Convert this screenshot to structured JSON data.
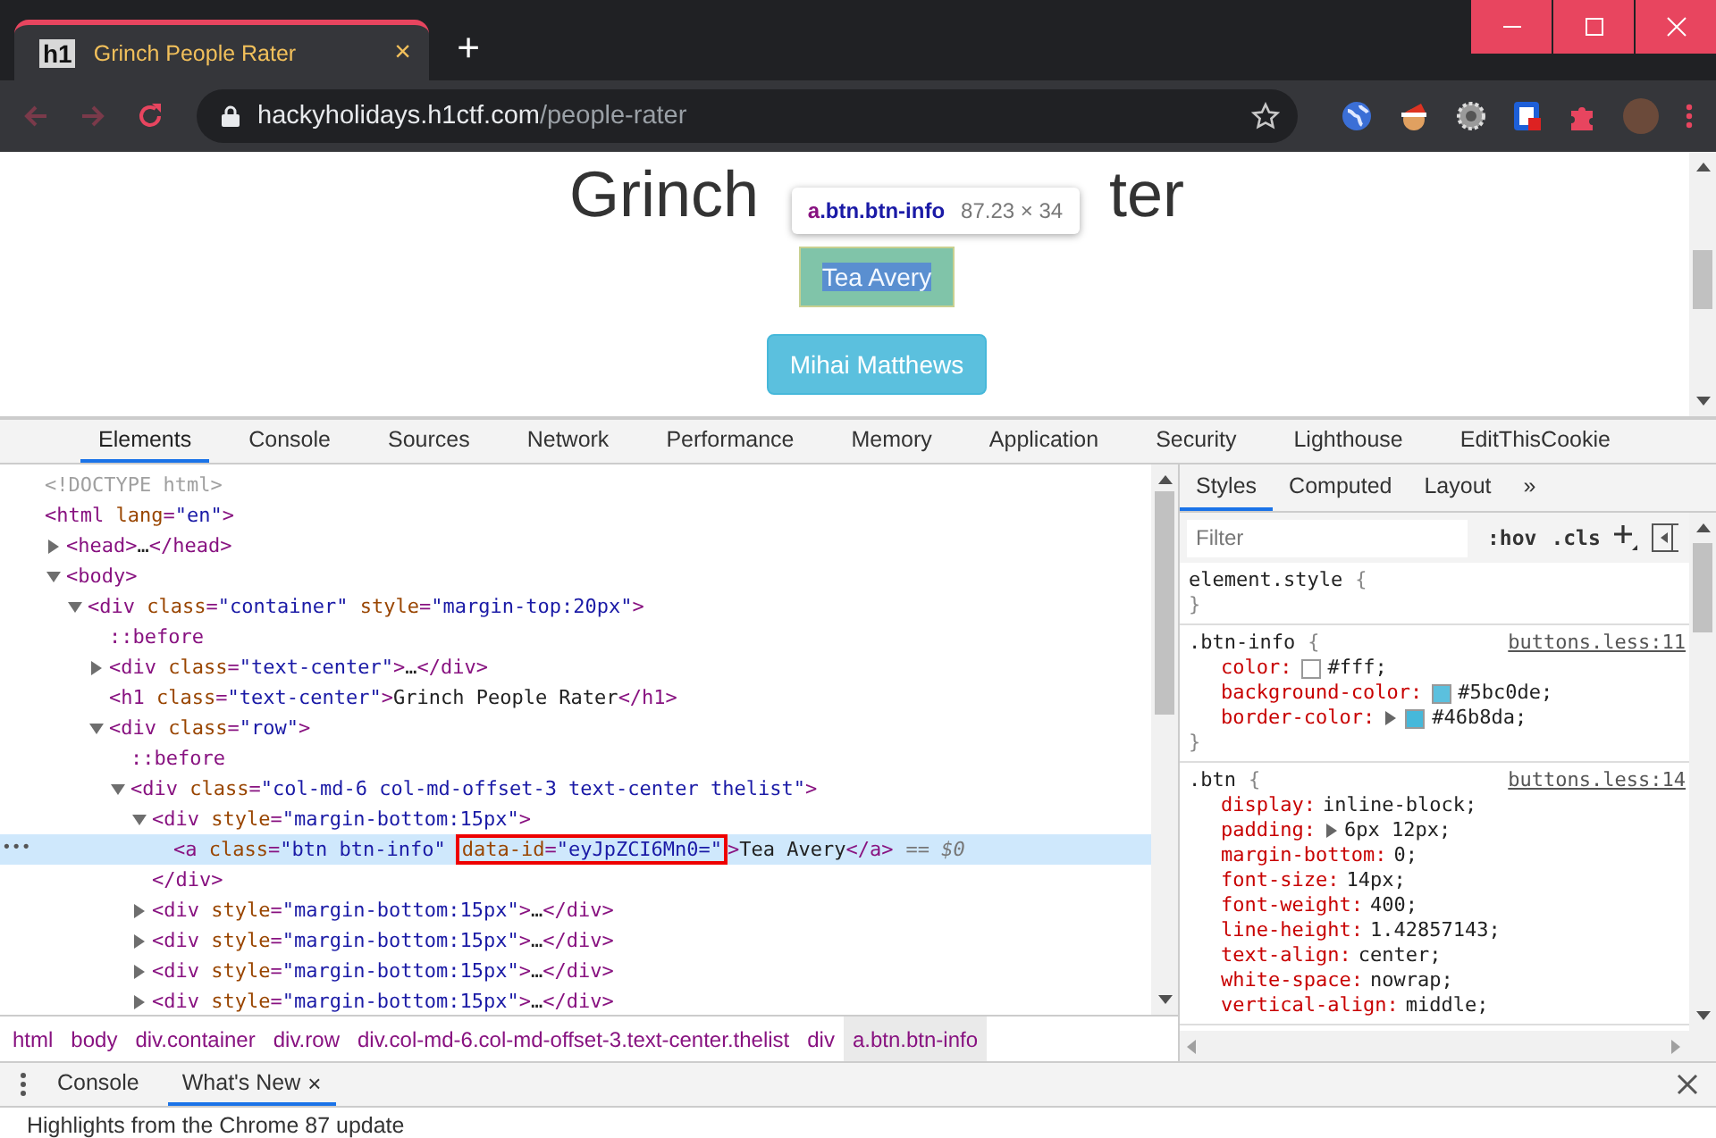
{
  "browser": {
    "tab": {
      "title": "Grinch People Rater",
      "favicon": "h1",
      "close": "×"
    },
    "new_tab": "+",
    "url": {
      "host": "hackyholidays.h1ctf.com",
      "path": "/people-rater"
    }
  },
  "page": {
    "heading": {
      "before": "Grinch",
      "after": "ter"
    },
    "buttons": [
      {
        "label": "Tea Avery",
        "inspected": true
      },
      {
        "label": "Mihai Matthews",
        "inspected": false
      }
    ],
    "tooltip": {
      "tag": "a",
      "classes": ".btn.btn-info",
      "size": "87.23 × 34"
    }
  },
  "devtools": {
    "tabs": [
      {
        "label": "Elements",
        "selected": true
      },
      {
        "label": "Console",
        "selected": false
      },
      {
        "label": "Sources",
        "selected": false
      },
      {
        "label": "Network",
        "selected": false
      },
      {
        "label": "Performance",
        "selected": false
      },
      {
        "label": "Memory",
        "selected": false
      },
      {
        "label": "Application",
        "selected": false
      },
      {
        "label": "Security",
        "selected": false
      },
      {
        "label": "Lighthouse",
        "selected": false
      },
      {
        "label": "EditThisCookie",
        "selected": false
      }
    ],
    "dom": [
      {
        "kind": "plain",
        "selected": false,
        "parts": [
          {
            "kind": "comment",
            "text": "<!DOCTYPE html>"
          }
        ]
      },
      {
        "kind": "plain",
        "selected": false,
        "parts": [
          {
            "kind": "tag",
            "text": "<html"
          },
          {
            "kind": "attr",
            "text": " lang"
          },
          {
            "kind": "tag",
            "text": "="
          },
          {
            "kind": "value",
            "text": "\"en\""
          },
          {
            "kind": "tag",
            "text": ">"
          }
        ],
        "children": [
          {
            "kind": "collapsible",
            "expanded": false,
            "selected": false,
            "parts": [
              {
                "kind": "tag",
                "text": "<head>"
              },
              {
                "kind": "text",
                "text": "…"
              },
              {
                "kind": "tag",
                "text": "</head>"
              }
            ]
          },
          {
            "kind": "collapsible",
            "expanded": true,
            "selected": false,
            "parts": [
              {
                "kind": "tag",
                "text": "<body>"
              }
            ],
            "children": [
              {
                "kind": "collapsible",
                "expanded": true,
                "selected": false,
                "parts": [
                  {
                    "kind": "tag",
                    "text": "<div"
                  },
                  {
                    "kind": "attr",
                    "text": " class"
                  },
                  {
                    "kind": "tag",
                    "text": "="
                  },
                  {
                    "kind": "value",
                    "text": "\"container\""
                  },
                  {
                    "kind": "attr",
                    "text": " style"
                  },
                  {
                    "kind": "tag",
                    "text": "="
                  },
                  {
                    "kind": "value",
                    "text": "\"margin-top:20px\""
                  },
                  {
                    "kind": "tag",
                    "text": ">"
                  }
                ],
                "children": [
                  {
                    "kind": "plain",
                    "selected": false,
                    "parts": [
                      {
                        "kind": "pseudo",
                        "text": "::before"
                      }
                    ]
                  },
                  {
                    "kind": "collapsible",
                    "expanded": false,
                    "selected": false,
                    "parts": [
                      {
                        "kind": "tag",
                        "text": "<div"
                      },
                      {
                        "kind": "attr",
                        "text": " class"
                      },
                      {
                        "kind": "tag",
                        "text": "="
                      },
                      {
                        "kind": "value",
                        "text": "\"text-center\""
                      },
                      {
                        "kind": "tag",
                        "text": ">"
                      },
                      {
                        "kind": "text",
                        "text": "…"
                      },
                      {
                        "kind": "tag",
                        "text": "</div>"
                      }
                    ]
                  },
                  {
                    "kind": "plain",
                    "selected": false,
                    "parts": [
                      {
                        "kind": "tag",
                        "text": "<h1"
                      },
                      {
                        "kind": "attr",
                        "text": " class"
                      },
                      {
                        "kind": "tag",
                        "text": "="
                      },
                      {
                        "kind": "value",
                        "text": "\"text-center\""
                      },
                      {
                        "kind": "tag",
                        "text": ">"
                      },
                      {
                        "kind": "text",
                        "text": "Grinch People Rater"
                      },
                      {
                        "kind": "tag",
                        "text": "</h1>"
                      }
                    ]
                  },
                  {
                    "kind": "collapsible",
                    "expanded": true,
                    "selected": false,
                    "parts": [
                      {
                        "kind": "tag",
                        "text": "<div"
                      },
                      {
                        "kind": "attr",
                        "text": " class"
                      },
                      {
                        "kind": "tag",
                        "text": "="
                      },
                      {
                        "kind": "value",
                        "text": "\"row\""
                      },
                      {
                        "kind": "tag",
                        "text": ">"
                      }
                    ],
                    "children": [
                      {
                        "kind": "plain",
                        "selected": false,
                        "parts": [
                          {
                            "kind": "pseudo",
                            "text": "::before"
                          }
                        ]
                      },
                      {
                        "kind": "collapsible",
                        "expanded": true,
                        "selected": false,
                        "parts": [
                          {
                            "kind": "tag",
                            "text": "<div"
                          },
                          {
                            "kind": "attr",
                            "text": " class"
                          },
                          {
                            "kind": "tag",
                            "text": "="
                          },
                          {
                            "kind": "value",
                            "text": "\"col-md-6 col-md-offset-3 text-center thelist\""
                          },
                          {
                            "kind": "tag",
                            "text": ">"
                          }
                        ],
                        "children": [
                          {
                            "kind": "collapsible",
                            "expanded": true,
                            "selected": false,
                            "parts": [
                              {
                                "kind": "tag",
                                "text": "<div"
                              },
                              {
                                "kind": "attr",
                                "text": " style"
                              },
                              {
                                "kind": "tag",
                                "text": "="
                              },
                              {
                                "kind": "value",
                                "text": "\"margin-bottom:15px\""
                              },
                              {
                                "kind": "tag",
                                "text": ">"
                              }
                            ],
                            "close": "</div>",
                            "children": [
                              {
                                "kind": "plain",
                                "selected": true,
                                "gutter": "•••",
                                "suffix": "== $0",
                                "parts": [
                                  {
                                    "kind": "tag",
                                    "text": "<a"
                                  },
                                  {
                                    "kind": "attr",
                                    "text": " class"
                                  },
                                  {
                                    "kind": "tag",
                                    "text": "="
                                  },
                                  {
                                    "kind": "value",
                                    "text": "\"btn btn-info\""
                                  },
                                  {
                                    "kind": "marked",
                                    "parts": [
                                      {
                                        "kind": "attr",
                                        "text": "data-id"
                                      },
                                      {
                                        "kind": "tag",
                                        "text": "="
                                      },
                                      {
                                        "kind": "value",
                                        "text": "\"eyJpZCI6Mn0=\""
                                      }
                                    ]
                                  },
                                  {
                                    "kind": "tag",
                                    "text": ">"
                                  },
                                  {
                                    "kind": "text",
                                    "text": "Tea Avery"
                                  },
                                  {
                                    "kind": "tag",
                                    "text": "</a>"
                                  }
                                ]
                              }
                            ]
                          },
                          {
                            "kind": "collapsible",
                            "expanded": false,
                            "selected": false,
                            "parts": [
                              {
                                "kind": "tag",
                                "text": "<div"
                              },
                              {
                                "kind": "attr",
                                "text": " style"
                              },
                              {
                                "kind": "tag",
                                "text": "="
                              },
                              {
                                "kind": "value",
                                "text": "\"margin-bottom:15px\""
                              },
                              {
                                "kind": "tag",
                                "text": ">"
                              },
                              {
                                "kind": "text",
                                "text": "…"
                              },
                              {
                                "kind": "tag",
                                "text": "</div>"
                              }
                            ]
                          },
                          {
                            "kind": "collapsible",
                            "expanded": false,
                            "selected": false,
                            "parts": [
                              {
                                "kind": "tag",
                                "text": "<div"
                              },
                              {
                                "kind": "attr",
                                "text": " style"
                              },
                              {
                                "kind": "tag",
                                "text": "="
                              },
                              {
                                "kind": "value",
                                "text": "\"margin-bottom:15px\""
                              },
                              {
                                "kind": "tag",
                                "text": ">"
                              },
                              {
                                "kind": "text",
                                "text": "…"
                              },
                              {
                                "kind": "tag",
                                "text": "</div>"
                              }
                            ]
                          },
                          {
                            "kind": "collapsible",
                            "expanded": false,
                            "selected": false,
                            "parts": [
                              {
                                "kind": "tag",
                                "text": "<div"
                              },
                              {
                                "kind": "attr",
                                "text": " style"
                              },
                              {
                                "kind": "tag",
                                "text": "="
                              },
                              {
                                "kind": "value",
                                "text": "\"margin-bottom:15px\""
                              },
                              {
                                "kind": "tag",
                                "text": ">"
                              },
                              {
                                "kind": "text",
                                "text": "…"
                              },
                              {
                                "kind": "tag",
                                "text": "</div>"
                              }
                            ]
                          },
                          {
                            "kind": "collapsible",
                            "expanded": false,
                            "selected": false,
                            "parts": [
                              {
                                "kind": "tag",
                                "text": "<div"
                              },
                              {
                                "kind": "attr",
                                "text": " style"
                              },
                              {
                                "kind": "tag",
                                "text": "="
                              },
                              {
                                "kind": "value",
                                "text": "\"margin-bottom:15px\""
                              },
                              {
                                "kind": "tag",
                                "text": ">"
                              },
                              {
                                "kind": "text",
                                "text": "…"
                              },
                              {
                                "kind": "tag",
                                "text": "</div>"
                              }
                            ]
                          }
                        ]
                      }
                    ]
                  }
                ]
              }
            ]
          }
        ]
      }
    ],
    "breadcrumbs": [
      {
        "label": "html",
        "selected": false
      },
      {
        "label": "body",
        "selected": false
      },
      {
        "label": "div.container",
        "selected": false
      },
      {
        "label": "div.row",
        "selected": false
      },
      {
        "label": "div.col-md-6.col-md-offset-3.text-center.thelist",
        "selected": false
      },
      {
        "label": "div",
        "selected": false
      },
      {
        "label": "a.btn.btn-info",
        "selected": true
      }
    ],
    "side_tabs": [
      {
        "label": "Styles",
        "selected": true
      },
      {
        "label": "Computed",
        "selected": false
      },
      {
        "label": "Layout",
        "selected": false
      },
      {
        "label": "»",
        "selected": false
      }
    ],
    "filter": {
      "placeholder": "Filter"
    },
    "filter_buttons": [
      ":hov",
      ".cls"
    ],
    "rules": [
      {
        "selector": "element.style",
        "open": "{",
        "close": "}"
      },
      {
        "selector": ".btn-info",
        "open": "{",
        "close": "}",
        "source": "buttons.less:11",
        "declarations": [
          {
            "kind": "color",
            "name": "color:",
            "value": "#fff;",
            "color": "#ffffff"
          },
          {
            "kind": "color",
            "name": "background-color:",
            "value": "#5bc0de;",
            "color": "#5bc0de"
          },
          {
            "kind": "color-shorthand",
            "name": "border-color:",
            "value": "#46b8da;",
            "color": "#46b8da"
          }
        ]
      },
      {
        "selector": ".btn",
        "open": "{",
        "source": "buttons.less:14",
        "declarations": [
          {
            "kind": "plain",
            "name": "display:",
            "value": "inline-block;"
          },
          {
            "kind": "shorthand",
            "name": "padding:",
            "value": "6px 12px;"
          },
          {
            "kind": "plain",
            "name": "margin-bottom:",
            "value": "0;"
          },
          {
            "kind": "plain",
            "name": "font-size:",
            "value": "14px;"
          },
          {
            "kind": "plain",
            "name": "font-weight:",
            "value": "400;"
          },
          {
            "kind": "plain",
            "name": "line-height:",
            "value": "1.42857143;"
          },
          {
            "kind": "plain",
            "name": "text-align:",
            "value": "center;"
          },
          {
            "kind": "plain",
            "name": "white-space:",
            "value": "nowrap;"
          },
          {
            "kind": "plain",
            "name": "vertical-align:",
            "value": "middle;"
          }
        ]
      }
    ],
    "drawer": {
      "tabs": [
        {
          "label": "Console",
          "selected": false,
          "closable": false
        },
        {
          "label": "What's New",
          "selected": true,
          "closable": true,
          "close": "×"
        }
      ],
      "content": "Highlights from the Chrome 87 update"
    }
  }
}
